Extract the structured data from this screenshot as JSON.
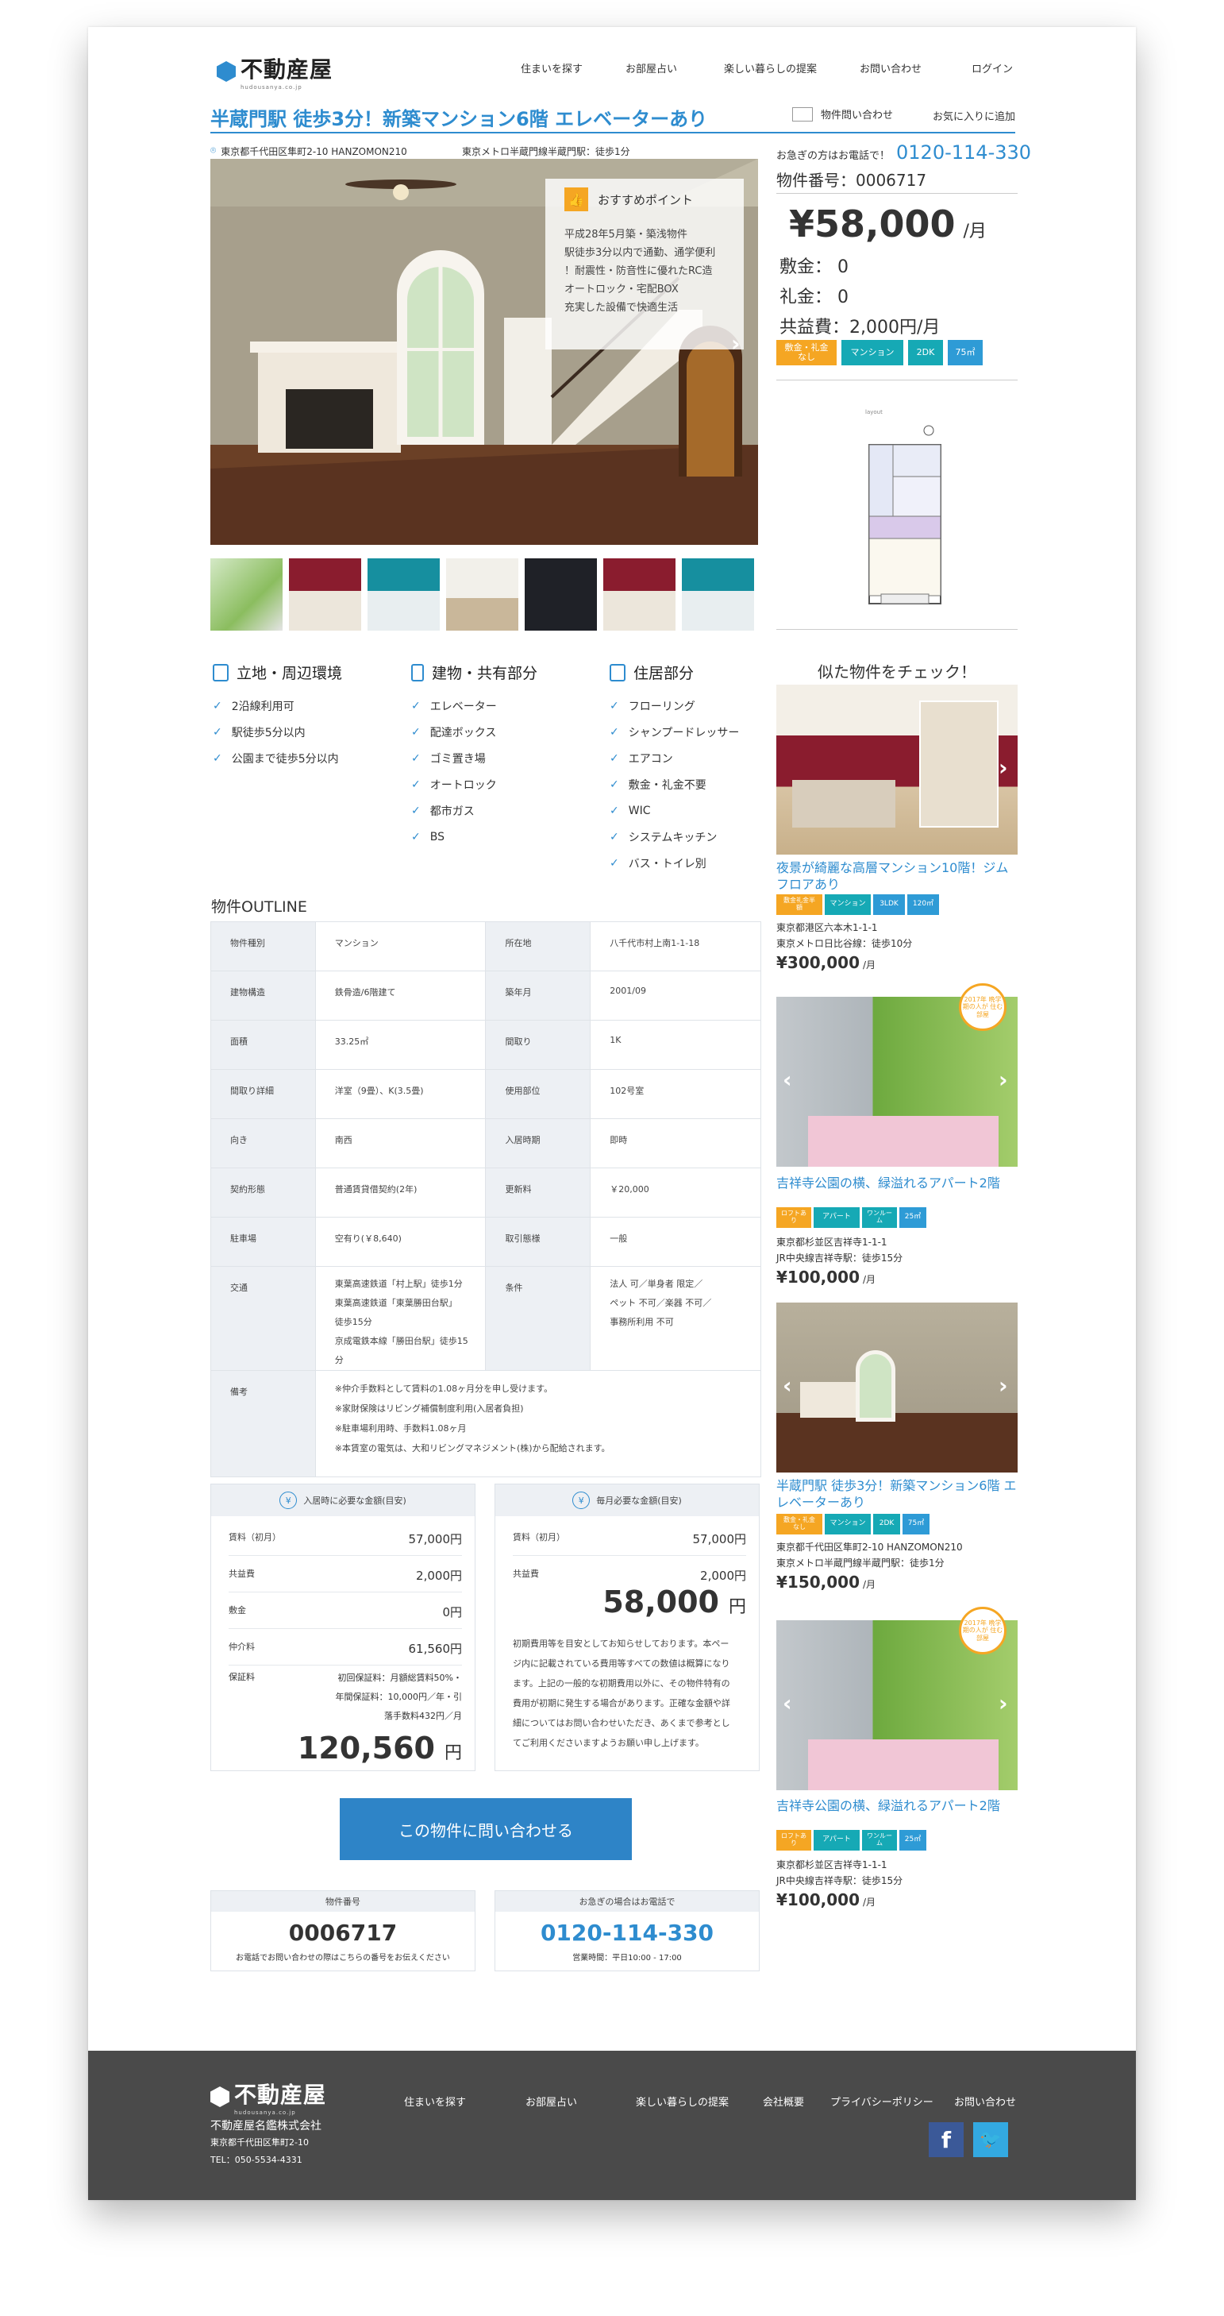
{
  "header": {
    "logo_text": "不動産屋",
    "logo_sub": "hudousanya.co.jp",
    "nav": [
      "住まいを探す",
      "お部屋占い",
      "楽しい暮らしの提案",
      "お問い合わせ",
      "ログイン"
    ]
  },
  "property": {
    "title": "半蔵門駅 徒歩3分！新築マンション6階 エレベーターあり",
    "address": "東京都千代田区隼町2-10 HANZOMON210",
    "station": "東京メトロ半蔵門線半蔵門駅：徒歩1分",
    "inquiry_link": "物件問い合わせ",
    "favorite_link": "お気に入りに追加",
    "phone_prefix": "お急ぎの方はお電話で！",
    "phone": "0120-114-330",
    "number_label": "物件番号：0006717",
    "price": "¥58,000",
    "price_unit": "/月",
    "shikikin": "敷金：  0",
    "reikin": "礼金：  0",
    "kyoeki": "共益費：2,000円/月",
    "tags": [
      "敷金・礼金なし",
      "マンション",
      "2DK",
      "75㎡"
    ],
    "floor_plan_label": "layout",
    "point_title": "おすすめポイント",
    "points": [
      "平成28年5月築・築浅物件",
      "駅徒歩3分以内で通勤、通学便利",
      "！耐震性・防音性に優れたRC造",
      "オートロック・宅配BOX",
      "充実した設備で快適生活"
    ]
  },
  "features": [
    {
      "title": "立地・周辺環境",
      "items": [
        "2沿線利用可",
        "駅徒歩5分以内",
        "公園まで徒歩5分以内"
      ]
    },
    {
      "title": "建物・共有部分",
      "items": [
        "エレベーター",
        "配達ボックス",
        "ゴミ置き場",
        "オートロック",
        "都市ガス",
        "BS"
      ]
    },
    {
      "title": "住居部分",
      "items": [
        "フローリング",
        "シャンプードレッサー",
        "エアコン",
        "敷金・礼金不要",
        "WIC",
        "システムキッチン",
        "バス・トイレ別"
      ]
    }
  ],
  "outline": {
    "title": "物件OUTLINE",
    "rows": [
      [
        "物件種別",
        "マンション",
        "所在地",
        "八千代市村上南1-1-18"
      ],
      [
        "建物構造",
        "鉄骨造/6階建て",
        "築年月",
        "2001/09"
      ],
      [
        "面積",
        "33.25㎡",
        "間取り",
        "1K"
      ],
      [
        "間取り詳細",
        "洋室（9畳）、K(3.5畳)",
        "使用部位",
        "102号室"
      ],
      [
        "向き",
        "南西",
        "入居時期",
        "即時"
      ],
      [
        "契約形態",
        "普通賃貸借契約(2年)",
        "更新料",
        "￥20,000"
      ],
      [
        "駐車場",
        "空有り(￥8,640)",
        "取引態様",
        "一般"
      ]
    ],
    "traffic_label": "交通",
    "traffic": [
      "東葉高速鉄道「村上駅」徒歩1分",
      "東葉高速鉄道「東葉勝田台駅」",
      "徒歩15分",
      "京成電鉄本線「勝田台駅」徒歩15分"
    ],
    "cond_label": "条件",
    "cond": [
      "法人 可／単身者 限定／",
      "ペット 不可／楽器 不可／",
      "事務所利用 不可"
    ],
    "notes_label": "備考",
    "notes": [
      "※仲介手数料として賃料の1.08ヶ月分を申し受けます。",
      "※家財保険はリビング補償制度利用(入居者負担)",
      "※駐車場利用時、手数料1.08ヶ月",
      "※本賃室の電気は、大和リビングマネジメント(株)から配給されます。"
    ]
  },
  "move_in": {
    "title": "入居時に必要な金額(目安)",
    "rows": [
      [
        "賃料（初月）",
        "57,000円"
      ],
      [
        "共益費",
        "2,000円"
      ],
      [
        "敷金",
        "0円"
      ],
      [
        "仲介料",
        "61,560円"
      ]
    ],
    "guarantee_label": "保証料",
    "guarantee": [
      "初回保証料：月額総賃料50%・",
      "年間保証料：10,000円／年・引",
      "落手数料432円／月"
    ],
    "total": "120,560",
    "total_unit": "円"
  },
  "monthly": {
    "title": "毎月必要な金額(目安)",
    "rows": [
      [
        "賃料（初月）",
        "57,000円"
      ],
      [
        "共益費",
        "2,000円"
      ]
    ],
    "total": "58,000",
    "total_unit": "円",
    "note": [
      "初期費用等を目安としてお知らせしております。本ペー",
      "ジ内に記載されている費用等すべての数値は概算になり",
      "ます。上記の一般的な初期費用以外に、その物件特有の",
      "費用が初期に発生する場合があります。正確な金額や詳",
      "細についてはお問い合わせいただき、あくまで参考とし",
      "てご利用くださいますようお願い申し上げます。"
    ]
  },
  "cta": "この物件に問い合わせる",
  "info_boxes": [
    {
      "head": "物件番号",
      "value": "0006717",
      "sub": "お電話でお問い合わせの際はこちらの番号をお伝えください"
    },
    {
      "head": "お急ぎの場合はお電話で",
      "value": "0120-114-330",
      "sub": "営業時間：平日10:00 - 17:00"
    }
  ],
  "similar": {
    "title": "似た物件をチェック！",
    "cards": [
      {
        "title": "夜景が綺麗な高層マンション10階！ジムフロアあり",
        "tags": [
          "敷金礼金半額",
          "マンション",
          "3LDK",
          "120㎡"
        ],
        "addr": "東京都港区六本木1-1-1",
        "station": "東京メトロ日比谷線：徒歩10分",
        "price": "¥300,000",
        "unit": "/月",
        "badge": ""
      },
      {
        "title": "吉祥寺公園の横、緑溢れるアパート2階",
        "tags": [
          "ロフトあり",
          "アパート",
          "ワンルーム",
          "25㎡"
        ],
        "addr": "東京都杉並区吉祥寺1-1-1",
        "station": "JR中央線吉祥寺駅：徒歩15分",
        "price": "¥100,000",
        "unit": "/月",
        "badge": "2017年 晩学期の人が 住む部屋"
      },
      {
        "title": "半蔵門駅 徒歩3分！新築マンション6階 エレベーターあり",
        "tags": [
          "敷金・礼金なし",
          "マンション",
          "2DK",
          "75㎡"
        ],
        "addr": "東京都千代田区隼町2-10 HANZOMON210",
        "station": "東京メトロ半蔵門線半蔵門駅：徒歩1分",
        "price": "¥150,000",
        "unit": "/月",
        "badge": ""
      },
      {
        "title": "吉祥寺公園の横、緑溢れるアパート2階",
        "tags": [
          "ロフトあり",
          "アパート",
          "ワンルーム",
          "25㎡"
        ],
        "addr": "東京都杉並区吉祥寺1-1-1",
        "station": "JR中央線吉祥寺駅：徒歩15分",
        "price": "¥100,000",
        "unit": "/月",
        "badge": "2017年 晩学期の人が 住む部屋"
      }
    ]
  },
  "footer": {
    "logo_text": "不動産屋",
    "logo_sub": "hudousanya.co.jp",
    "company": "不動産屋名鑑株式会社",
    "address": "東京都千代田区隼町2-10",
    "tel": "TEL：050-5534-4331",
    "nav": [
      "住まいを探す",
      "お部屋占い",
      "楽しい暮らしの提案",
      "会社概要",
      "プライバシーポリシー",
      "お問い合わせ"
    ]
  },
  "colors": {
    "accent": "#2e8ccf",
    "orange": "#f5a623",
    "teal": "#16a9b5",
    "footer": "#4a4a4a"
  }
}
